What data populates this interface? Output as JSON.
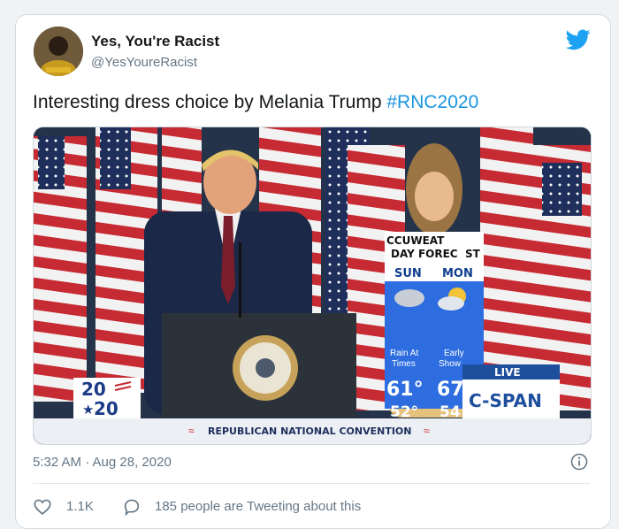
{
  "user": {
    "display_name": "Yes, You're Racist",
    "handle": "@YesYoureRacist",
    "avatar_icon": "avatar-portrait"
  },
  "tweet": {
    "text": "Interesting dress choice by Melania Trump ",
    "hashtag": "#RNC2020",
    "hashtag_color": "#1b95e0"
  },
  "media": {
    "logo_2020_top": "20",
    "logo_2020_bottom": "20",
    "banner": "REPUBLICAN NATIONAL CONVENTION",
    "live_label": "LIVE",
    "network": "C-SPAN",
    "forecast": {
      "brand": "CCUWEAT",
      "subtitle": "DAY FOREC",
      "subtitle_end": "ST",
      "day1": "SUN",
      "day2": "MON",
      "desc1_line1": "Rain At",
      "desc1_line2": "Times",
      "desc2_line1": "Early",
      "desc2_line2": "Show",
      "high1": "61°",
      "high2": "67",
      "low1": "52°",
      "low2": "54"
    }
  },
  "meta": {
    "timestamp": "5:32 AM · Aug 28, 2020",
    "likes": "1.1K",
    "conversation": "185 people are Tweeting about this"
  },
  "colors": {
    "twitter_blue": "#1da1f2",
    "secondary_text": "#657786",
    "cspan_blue": "#1d4f9c"
  }
}
